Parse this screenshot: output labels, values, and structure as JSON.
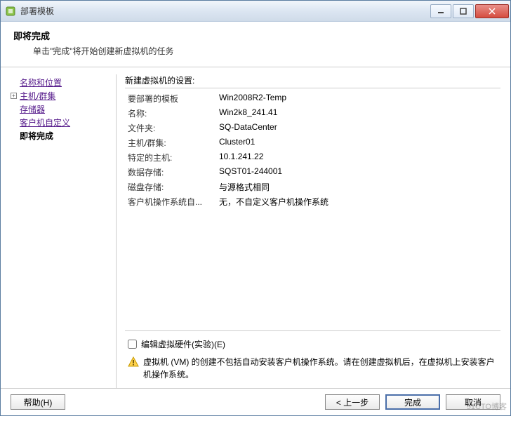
{
  "window": {
    "title": "部署模板"
  },
  "header": {
    "title": "即将完成",
    "subtitle": "单击\"完成\"将开始创建新虚拟机的任务"
  },
  "sidebar": {
    "items": [
      {
        "label": "名称和位置",
        "expandable": false
      },
      {
        "label": "主机/群集",
        "expandable": true
      },
      {
        "label": "存储器",
        "expandable": false
      },
      {
        "label": "客户机自定义",
        "expandable": false
      }
    ],
    "current": "即将完成"
  },
  "main": {
    "heading": "新建虚拟机的设置:",
    "rows": [
      {
        "label": "要部署的模板",
        "value": "Win2008R2-Temp"
      },
      {
        "label": "名称:",
        "value": "Win2k8_241.41"
      },
      {
        "label": "文件夹:",
        "value": "SQ-DataCenter"
      },
      {
        "label": "主机/群集:",
        "value": "Cluster01"
      },
      {
        "label": "特定的主机:",
        "value": "10.1.241.22"
      },
      {
        "label": "数据存储:",
        "value": "SQST01-244001"
      },
      {
        "label": "磁盘存储:",
        "value": "与源格式相同"
      },
      {
        "label": "客户机操作系统自...",
        "value": "无，不自定义客户机操作系统"
      }
    ],
    "checkbox_label": "编辑虚拟硬件(实验)(E)",
    "warning_text": "虚拟机 (VM) 的创建不包括自动安装客户机操作系统。请在创建虚拟机后，在虚拟机上安装客户机操作系统。"
  },
  "footer": {
    "help": "帮助(H)",
    "back": "< 上一步",
    "finish": "完成",
    "cancel": "取消"
  },
  "watermark": "51CTO博客"
}
